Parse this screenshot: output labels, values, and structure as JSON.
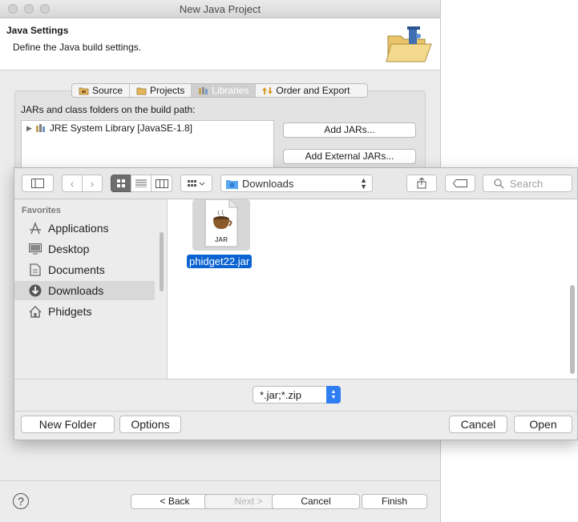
{
  "wizard": {
    "title": "New Java Project",
    "banner_title": "Java Settings",
    "banner_description": "Define the Java build settings.",
    "tabs": [
      {
        "label": "Source",
        "icon": "source-folder-icon",
        "active": false
      },
      {
        "label": "Projects",
        "icon": "projects-folder-icon",
        "active": false
      },
      {
        "label": "Libraries",
        "icon": "libraries-icon",
        "active": true
      },
      {
        "label": "Order and Export",
        "icon": "order-export-icon",
        "active": false
      }
    ],
    "paths_label": "JARs and class folders on the build path:",
    "tree_items": [
      {
        "label": "JRE System Library [JavaSE-1.8]",
        "icon": "library-icon",
        "expanded": false
      }
    ],
    "add_jars_label": "Add JARs...",
    "add_external_jars_label": "Add External JARs...",
    "buttons": {
      "back": "< Back",
      "next": "Next >",
      "cancel": "Cancel",
      "finish": "Finish"
    },
    "help_icon_glyph": "?"
  },
  "chooser": {
    "location": "Downloads",
    "search_placeholder": "Search",
    "sidebar_header": "Favorites",
    "sidebar_items": [
      {
        "label": "Applications",
        "icon": "applications-icon"
      },
      {
        "label": "Desktop",
        "icon": "desktop-icon"
      },
      {
        "label": "Documents",
        "icon": "documents-icon"
      },
      {
        "label": "Downloads",
        "icon": "downloads-icon",
        "selected": true
      },
      {
        "label": "Phidgets",
        "icon": "home-icon"
      }
    ],
    "files": [
      {
        "name": "phidget22.jar",
        "type_label": "JAR",
        "selected": true
      }
    ],
    "filter_value": "*.jar;*.zip",
    "new_folder_label": "New Folder",
    "options_label": "Options",
    "cancel_label": "Cancel",
    "open_label": "Open"
  },
  "colors": {
    "selection_blue": "#0b63d1",
    "accent_blue": "#2f7ef2"
  }
}
